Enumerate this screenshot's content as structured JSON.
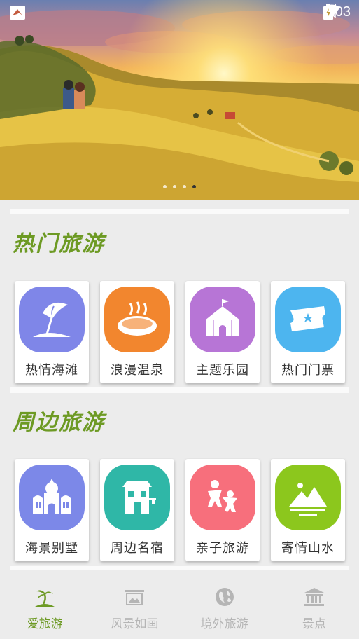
{
  "status_bar": {
    "time": "5:03"
  },
  "banner": {
    "slides": 4,
    "active_slide": 4
  },
  "sections": [
    {
      "title": "热门旅游",
      "items": [
        {
          "label": "热情海滩",
          "icon": "beach-umbrella-icon",
          "color": "#7f86e8"
        },
        {
          "label": "浪漫温泉",
          "icon": "hot-spring-icon",
          "color": "#f2862e"
        },
        {
          "label": "主题乐园",
          "icon": "circus-tent-icon",
          "color": "#b775d6"
        },
        {
          "label": "热门门票",
          "icon": "ticket-icon",
          "color": "#4db5ef"
        }
      ]
    },
    {
      "title": "周边旅游",
      "items": [
        {
          "label": "海景别墅",
          "icon": "villa-icon",
          "color": "#7c88e8"
        },
        {
          "label": "周边名宿",
          "icon": "guesthouse-icon",
          "color": "#2fb7a7"
        },
        {
          "label": "亲子旅游",
          "icon": "family-icon",
          "color": "#f76f7c"
        },
        {
          "label": "寄情山水",
          "icon": "mountain-icon",
          "color": "#8cc71d"
        }
      ]
    }
  ],
  "bottom_nav": [
    {
      "label": "爱旅游",
      "icon": "palm-island-icon",
      "active": true
    },
    {
      "label": "风景如画",
      "icon": "picture-frame-icon",
      "active": false
    },
    {
      "label": "境外旅游",
      "icon": "globe-icon",
      "active": false
    },
    {
      "label": "景点",
      "icon": "landmark-icon",
      "active": false
    }
  ],
  "colors": {
    "accent": "#6d9a24",
    "inactive": "#b5b5b5"
  }
}
